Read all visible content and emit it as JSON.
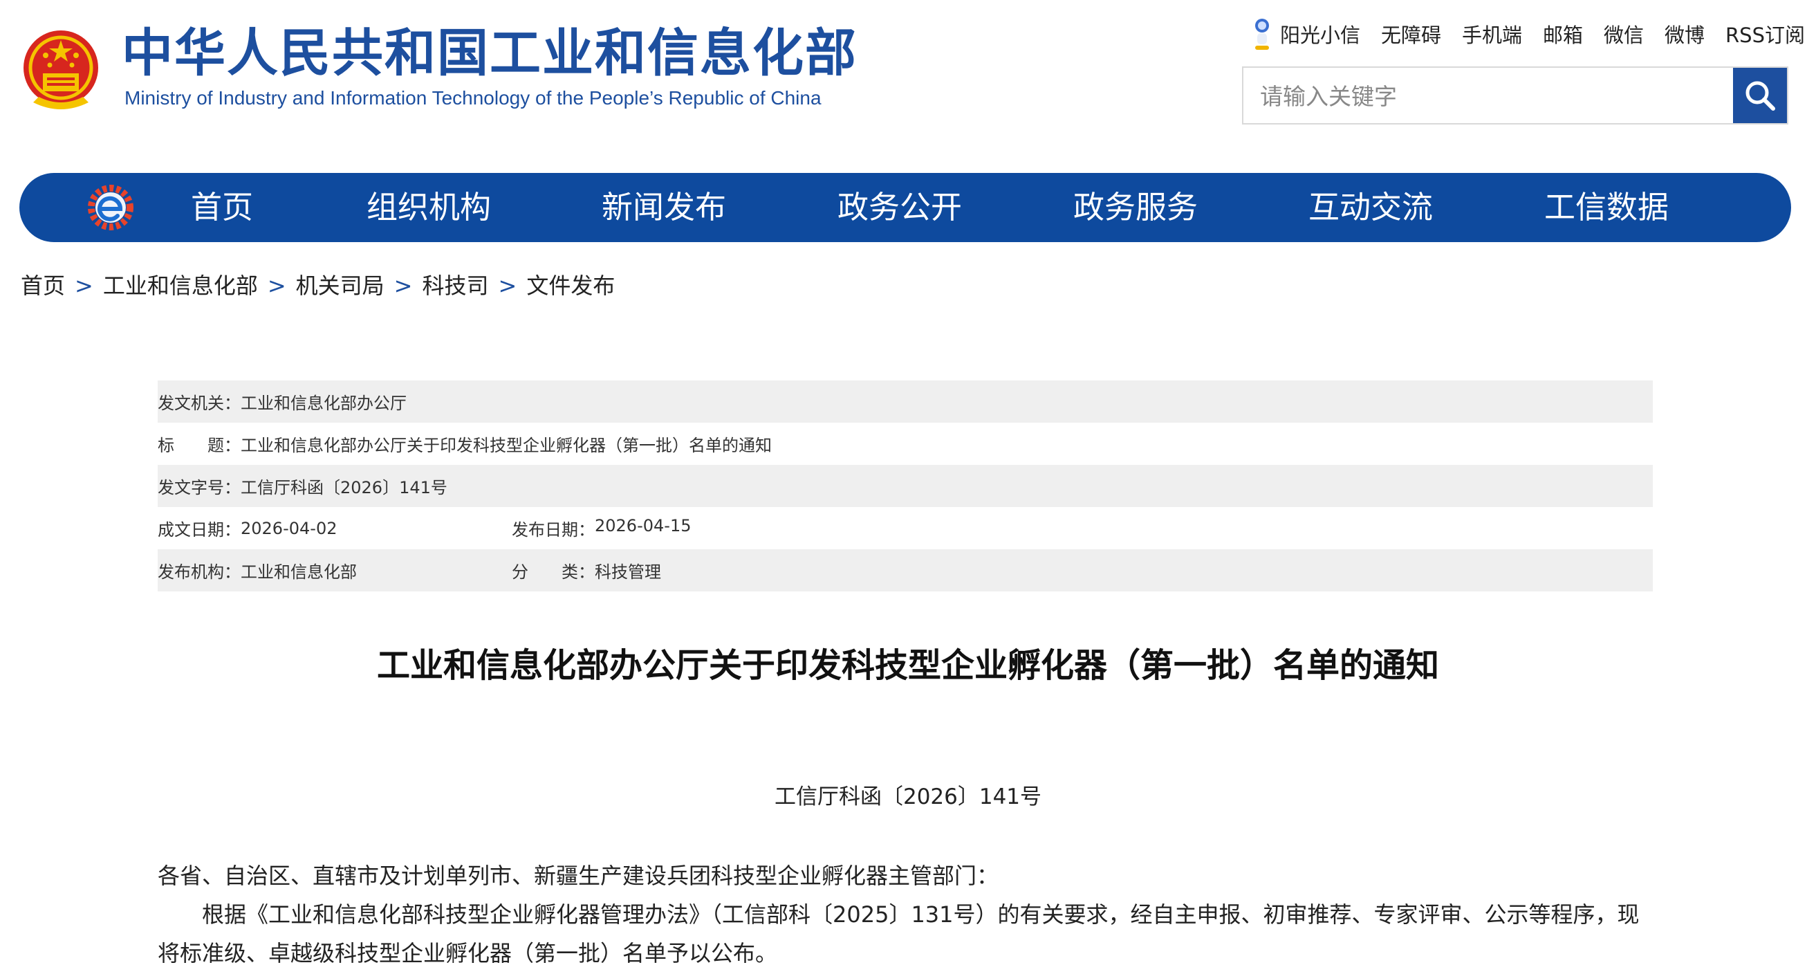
{
  "header": {
    "title_cn": "中华人民共和国工业和信息化部",
    "title_en": "Ministry of Industry and Information Technology of the People’s Republic of China",
    "links": [
      "阳光小信",
      "无障碍",
      "手机端",
      "邮箱",
      "微信",
      "微博",
      "RSS订阅"
    ],
    "search_placeholder": "请输入关键字"
  },
  "nav": {
    "items": [
      "首页",
      "组织机构",
      "新闻发布",
      "政务公开",
      "政务服务",
      "互动交流",
      "工信数据"
    ]
  },
  "breadcrumb": [
    "首页",
    "工业和信息化部",
    "机关司局",
    "科技司",
    "文件发布"
  ],
  "breadcrumb_sep": ">",
  "meta": {
    "issuer_label": "发文机关：",
    "issuer": "工业和信息化部办公厅",
    "title_label": "标　　题：",
    "title": "工业和信息化部办公厅关于印发科技型企业孵化器（第一批）名单的通知",
    "docno_label": "发文字号：",
    "docno": "工信厅科函〔2026〕141号",
    "written_label": "成文日期：",
    "written": "2026-04-02",
    "published_label": "发布日期：",
    "published": "2026-04-15",
    "agency_label": "发布机构：",
    "agency": "工业和信息化部",
    "category_label": "分　　类：",
    "category": "科技管理"
  },
  "article": {
    "title": "工业和信息化部办公厅关于印发科技型企业孵化器（第一批）名单的通知",
    "doc_number": "工信厅科函〔2026〕141号",
    "salutation": "各省、自治区、直辖市及计划单列市、新疆生产建设兵团科技型企业孵化器主管部门：",
    "paragraph": "根据《工业和信息化部科技型企业孵化器管理办法》（工信部科〔2025〕131号）的有关要求，经自主申报、初审推荐、专家评审、公示等程序，现将标准级、卓越级科技型企业孵化器（第一批）名单予以公布。"
  },
  "colors": {
    "brand_blue": "#0e4a9e",
    "title_blue": "#1d4f9f",
    "meta_row_bg": "#efefef"
  },
  "icons": [
    "national-emblem-icon",
    "mascot-icon",
    "search-icon",
    "gear-e-logo-icon"
  ]
}
